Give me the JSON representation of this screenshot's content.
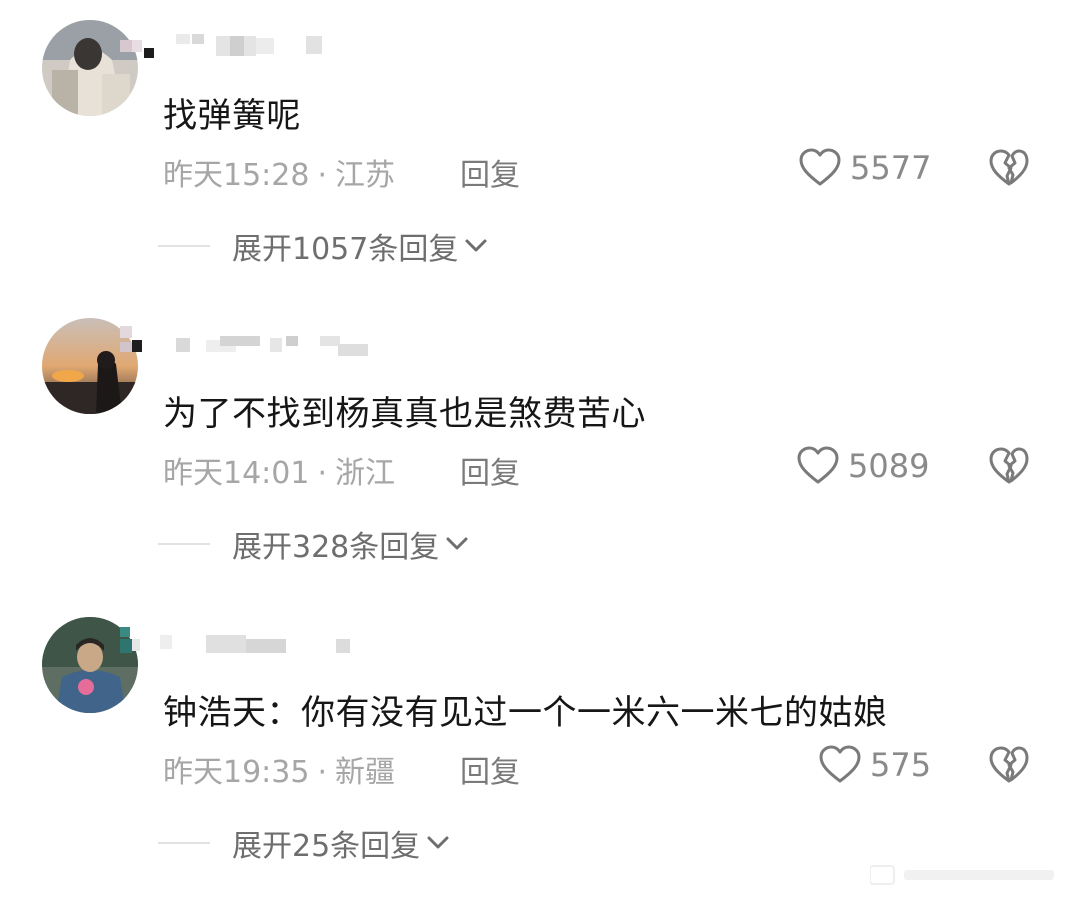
{
  "comments": [
    {
      "content": "找弹簧呢",
      "time": "昨天15:28",
      "location": "江苏",
      "reply_label": "回复",
      "likes": "5577",
      "expand_label": "展开1057条回复"
    },
    {
      "content": "为了不找到杨真真也是煞费苦心",
      "time": "昨天14:01",
      "location": "浙江",
      "reply_label": "回复",
      "likes": "5089",
      "expand_label": "展开328条回复"
    },
    {
      "content": "钟浩天：你有没有见过一个一米六一米七的姑娘",
      "time": "昨天19:35",
      "location": "新疆",
      "reply_label": "回复",
      "likes": "575",
      "expand_label": "展开25条回复"
    }
  ],
  "meta_separator": "·",
  "icons": {
    "like": "heart-outline-icon",
    "dislike": "broken-heart-icon",
    "expand": "chevron-down-icon"
  },
  "colors": {
    "text_primary": "#161616",
    "text_meta": "#a6a6a6",
    "icon_gray": "#7a7a7a"
  }
}
